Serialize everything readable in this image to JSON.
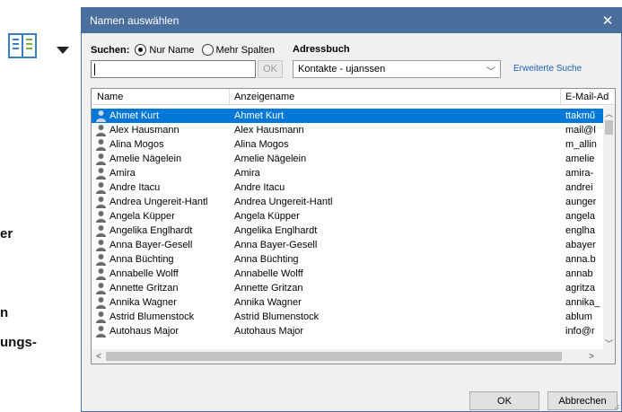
{
  "background": {
    "fragments": [
      "er",
      "n",
      "ungs-"
    ]
  },
  "dialog": {
    "title": "Namen auswählen",
    "close_glyph": "✕",
    "search_label": "Suchen:",
    "radio_name_only": "Nur Name",
    "radio_more_columns": "Mehr Spalten",
    "addressbook_label": "Adressbuch",
    "search_value": "",
    "ok_small": "OK",
    "addressbook_selected": "Kontakte - ujanssen",
    "advanced_search": "Erweiterte Suche",
    "columns": [
      "Name",
      "Anzeigename",
      "E-Mail-Ad"
    ],
    "rows": [
      {
        "name": "Ahmet Kurt",
        "display": "Ahmet Kurt",
        "email": "ttakmű",
        "selected": true
      },
      {
        "name": "Alex Hausmann",
        "display": "Alex Hausmann",
        "email": "mail@l"
      },
      {
        "name": "Alina Mogos",
        "display": "Alina Mogos",
        "email": "m_allin"
      },
      {
        "name": "Amelie Nägelein",
        "display": "Amelie Nägelein",
        "email": "amelie"
      },
      {
        "name": "Amira",
        "display": "Amira",
        "email": "amira-"
      },
      {
        "name": "Andre Itacu",
        "display": "Andre Itacu",
        "email": "andrei"
      },
      {
        "name": "Andrea Ungereit-Hantl",
        "display": "Andrea Ungereit-Hantl",
        "email": "aunger"
      },
      {
        "name": "Angela Küpper",
        "display": "Angela Küpper",
        "email": "angela"
      },
      {
        "name": "Angelika Englhardt",
        "display": "Angelika Englhardt",
        "email": "englha"
      },
      {
        "name": "Anna Bayer-Gesell",
        "display": "Anna Bayer-Gesell",
        "email": "abayer"
      },
      {
        "name": "Anna Büchting",
        "display": "Anna Büchting",
        "email": "anna.b"
      },
      {
        "name": "Annabelle Wolff",
        "display": "Annabelle Wolff",
        "email": "annab"
      },
      {
        "name": "Annette Gritzan",
        "display": "Annette Gritzan",
        "email": "agritza"
      },
      {
        "name": "Annika Wagner",
        "display": "Annika Wagner",
        "email": "annika_"
      },
      {
        "name": "Astrid Blumenstock",
        "display": "Astrid Blumenstock",
        "email": "ablum"
      },
      {
        "name": "Autohaus Major",
        "display": "Autohaus Major",
        "email": "info@r"
      }
    ],
    "ok_button": "OK",
    "cancel_button": "Abbrechen"
  },
  "colors": {
    "titlebar": "#4a6f9d",
    "selection": "#0078d7",
    "link": "#1a5fb4"
  },
  "icons": [
    "address-book-icon",
    "contact-person-icon",
    "close-icon",
    "chevron-down-icon",
    "scroll-arrow-icon"
  ]
}
